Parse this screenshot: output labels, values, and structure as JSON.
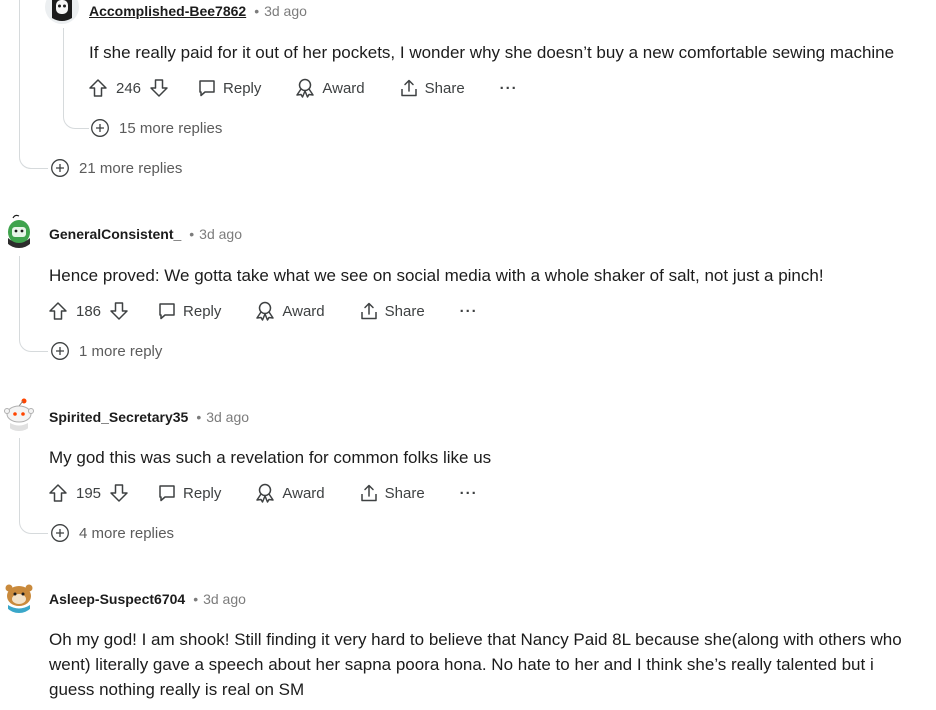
{
  "colors": {
    "text": "#1c1c1c",
    "meta": "#7c7c7c",
    "action": "#3e4142",
    "thread_line": "#d6dadc"
  },
  "comment1": {
    "username": "Accomplished-Bee7862",
    "time": "3d ago",
    "body": "If she really paid for it out of her pockets, I wonder why she doesn’t buy a new comfortable sewing machine",
    "votes": "246",
    "reply_label": "Reply",
    "award_label": "Award",
    "share_label": "Share",
    "more_replies": "15 more replies"
  },
  "parent_more_replies": "21 more replies",
  "comment2": {
    "username": "GeneralConsistent_",
    "time": "3d ago",
    "body": "Hence proved: We gotta take what we see on social media with a whole shaker of salt, not just a pinch!",
    "votes": "186",
    "reply_label": "Reply",
    "award_label": "Award",
    "share_label": "Share",
    "more_replies": "1 more reply"
  },
  "comment3": {
    "username": "Spirited_Secretary35",
    "time": "3d ago",
    "body": "My god this was such a revelation for common folks like us",
    "votes": "195",
    "reply_label": "Reply",
    "award_label": "Award",
    "share_label": "Share",
    "more_replies": "4 more replies"
  },
  "comment4": {
    "username": "Asleep-Suspect6704",
    "time": "3d ago",
    "body_line1": "Oh my god! I am shook! Still finding it very hard to believe that Nancy Paid 8L because she(along with others who",
    "body_line2": "went) literally gave a speech about her sapna poora hona. No hate to her and I think she’s really talented but i",
    "body_line3": "guess nothing really is real on SM"
  },
  "icons": {
    "upvote": "upvote-arrow-icon",
    "downvote": "downvote-arrow-icon",
    "reply": "speech-bubble-icon",
    "award": "award-ribbon-icon",
    "share": "share-upload-icon",
    "more": "ellipsis-icon",
    "expand": "plus-circle-icon"
  }
}
